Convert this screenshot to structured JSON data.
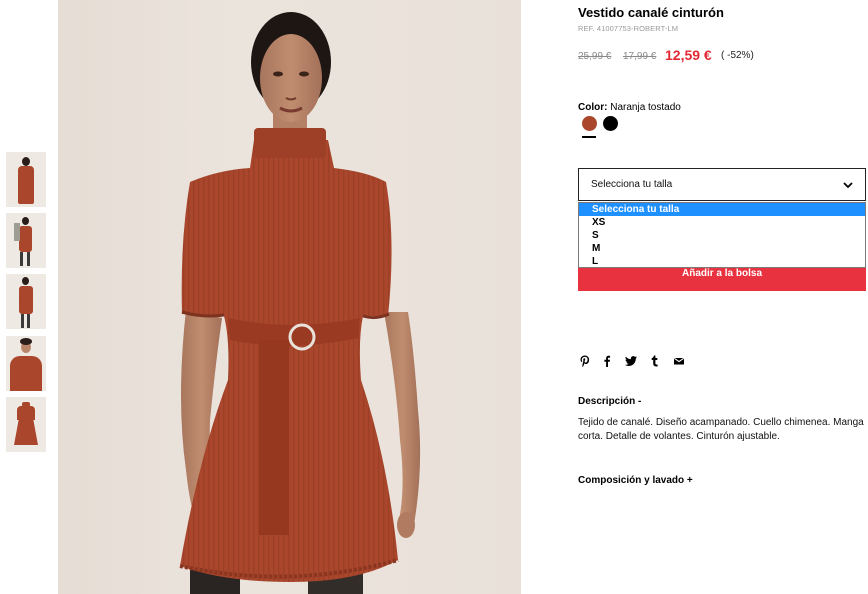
{
  "product": {
    "title": "Vestido canalé cinturón",
    "ref": "REF. 41007753-ROBERT-LM",
    "price_old_1": "25,99 €",
    "price_old_2": "17,99 €",
    "price_new": "12,59 €",
    "discount": "( -52%)"
  },
  "color": {
    "label": "Color:",
    "value": "Naranja tostado",
    "swatches": [
      {
        "name": "naranja-tostado",
        "hex": "#a9462c"
      },
      {
        "name": "negro",
        "hex": "#000000"
      }
    ]
  },
  "size": {
    "select_label": "Selecciona tu talla",
    "options": [
      "Selecciona tu talla",
      "XS",
      "S",
      "M",
      "L"
    ],
    "selected_index": 0
  },
  "cart": {
    "add_label": "Añadir a la bolsa"
  },
  "share": {
    "icons": [
      "pinterest-icon",
      "facebook-icon",
      "twitter-icon",
      "tumblr-icon",
      "email-icon"
    ]
  },
  "description": {
    "title": "Descripción -",
    "text": "Tejido de canalé. Diseño acampanado. Cuello chimenea. Manga corta. Detalle de volantes. Cinturón ajustable."
  },
  "composition": {
    "title": "Composición y lavado +"
  },
  "colors": {
    "accent_red": "#e32a34",
    "button_red": "#e8323f",
    "dropdown_highlight": "#1e90ff",
    "dress": "#a9462c"
  }
}
